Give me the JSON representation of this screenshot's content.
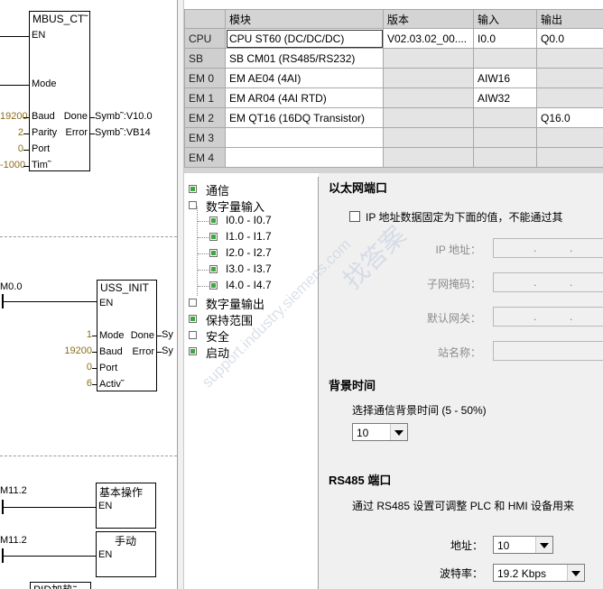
{
  "ladder": {
    "mbus": {
      "title": "MBUS_CT˜",
      "en": "EN",
      "mode": "Mode",
      "baud": "Baud",
      "parity": "Parity",
      "port": "Port",
      "timeout": "Tim˜",
      "done": "Done",
      "error": "Error",
      "out_done": "Symb˜:V10.0",
      "out_error": "Symb˜:VB14",
      "val_baud": "19200",
      "val_parity": "2",
      "val_port": "0",
      "val_timeout": "-1000"
    },
    "uss": {
      "contact": "M0.0",
      "title": "USS_INIT",
      "en": "EN",
      "mode": "Mode",
      "baud": "Baud",
      "port": "Port",
      "active": "Activ˜",
      "done": "Done",
      "error": "Error",
      "out_done": "Sy",
      "out_error": "Sy",
      "val_mode": "1",
      "val_baud": "19200",
      "val_port": "0",
      "val_active": "6"
    },
    "basic": {
      "contact": "M11.2",
      "title": "基本操作",
      "en": "EN"
    },
    "manual": {
      "contact": "M11.2",
      "title": "手动",
      "en": "EN"
    },
    "pid": {
      "title": "PID加热˜"
    }
  },
  "table": {
    "headers": [
      "模块",
      "版本",
      "输入",
      "输出"
    ],
    "rows": [
      {
        "slot": "CPU",
        "module": "CPU ST60 (DC/DC/DC)",
        "version": "V02.03.02_00....",
        "input": "I0.0",
        "output": "Q0.0"
      },
      {
        "slot": "SB",
        "module": "SB CM01 (RS485/RS232)",
        "version": "",
        "input": "",
        "output": ""
      },
      {
        "slot": "EM 0",
        "module": "EM AE04 (4AI)",
        "version": "",
        "input": "AIW16",
        "output": ""
      },
      {
        "slot": "EM 1",
        "module": "EM AR04 (4AI RTD)",
        "version": "",
        "input": "AIW32",
        "output": ""
      },
      {
        "slot": "EM 2",
        "module": "EM QT16 (16DQ Transistor)",
        "version": "",
        "input": "",
        "output": "Q16.0"
      },
      {
        "slot": "EM 3",
        "module": "",
        "version": "",
        "input": "",
        "output": ""
      },
      {
        "slot": "EM 4",
        "module": "",
        "version": "",
        "input": "",
        "output": ""
      }
    ]
  },
  "tree": {
    "communication": "通信",
    "digital_input": "数字量输入",
    "di_groups": [
      "I0.0 - I0.7",
      "I1.0 - I1.7",
      "I2.0 - I2.7",
      "I3.0 - I3.7",
      "I4.0 - I4.7"
    ],
    "digital_output": "数字量输出",
    "retentive": "保持范围",
    "security": "安全",
    "startup": "启动"
  },
  "props": {
    "ethernet_title": "以太网端口",
    "ip_fixed_label": "IP 地址数据固定为下面的值，不能通过其",
    "ip_label": "IP 地址：",
    "subnet_label": "子网掩码：",
    "gateway_label": "默认网关：",
    "station_label": "站名称：",
    "ip_dot": ".",
    "background_title": "背景时间",
    "background_desc": "选择通信背景时间 (5 - 50%)",
    "background_value": "10",
    "rs485_title": "RS485  端口",
    "rs485_desc": "通过 RS485 设置可调整 PLC 和 HMI 设备用来",
    "address_label": "地址：",
    "address_value": "10",
    "baud_label": "波特率：",
    "baud_value": "19.2 Kbps"
  },
  "watermark": {
    "text1": "support.industry.siemens.com",
    "text2": "找答案"
  },
  "colors": {
    "table_header": "#d4d4d4",
    "row_header": "#cfcfcf",
    "tree_check": "#3da83d",
    "panel_bg": "#f0f0f0",
    "num": "#8a6d1a"
  }
}
